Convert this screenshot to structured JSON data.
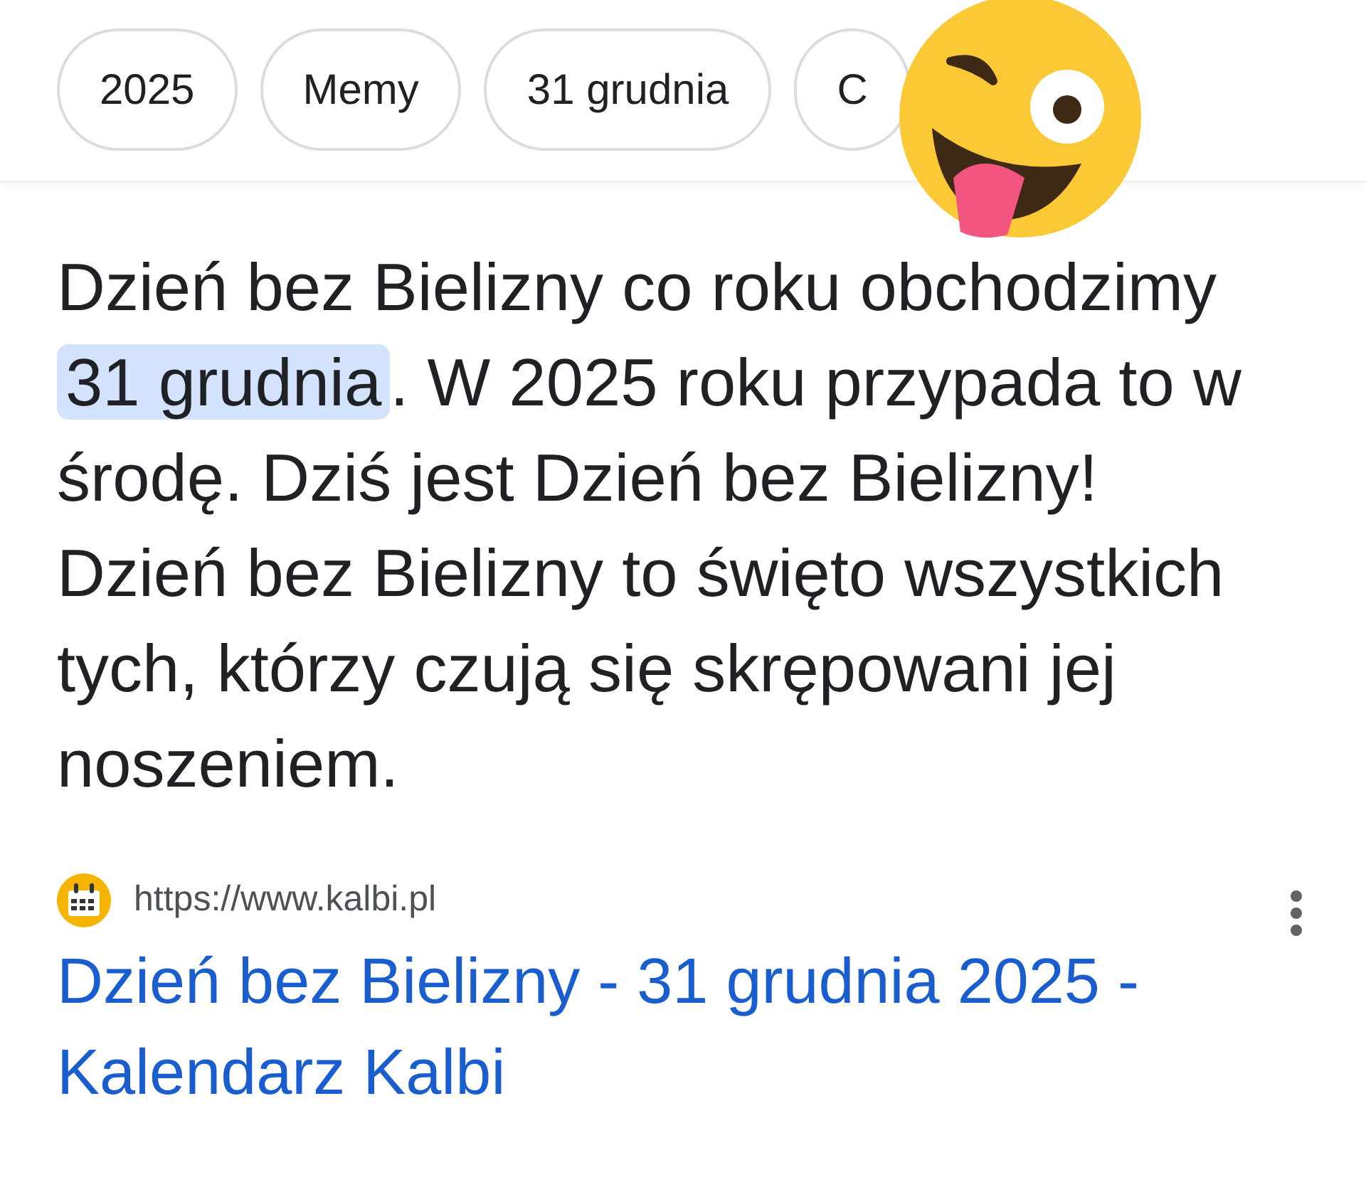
{
  "chips": [
    {
      "label": "2025"
    },
    {
      "label": "Memy"
    },
    {
      "label": "31 grudnia"
    },
    {
      "label": "C"
    }
  ],
  "answer": [
    {
      "text": "Dzień bez Bielizny co roku obchodzimy ",
      "highlighted": false
    },
    {
      "text": "31 grudnia",
      "highlighted": true
    },
    {
      "text": ". W 2025 roku przypada to w środę. Dziś jest Dzień bez Bielizny! Dzień bez Bielizny to święto wszystkich tych, którzy czują się skrępowani jej noszeniem.",
      "highlighted": false
    }
  ],
  "source": {
    "url": "https://www.kalbi.pl",
    "title": "Dzień bez Bielizny - 31 grudnia 2025 - Kalendarz Kalbi"
  }
}
